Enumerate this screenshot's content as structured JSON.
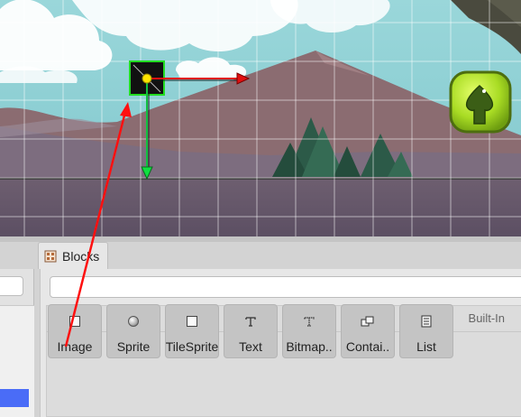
{
  "colors": {
    "sky": "#8fd3d8",
    "mountain": "#8a6a6e",
    "ground": "#6a5a6e",
    "selection_accent": "#4a6cf7",
    "x_axis_arrow": "#e01010",
    "y_axis_arrow": "#10c040",
    "gizmo_border": "#22dd22",
    "pointer_arrow": "#ff1010",
    "home_button": "#9fdc2a"
  },
  "scene": {
    "elements": [
      {
        "name": "transform-gizmo",
        "kind": "selected-object"
      },
      {
        "name": "home-button",
        "icon": "up-arrow-icon"
      }
    ]
  },
  "tabs": [
    {
      "label": "Blocks",
      "icon": "blocks-tab-icon"
    }
  ],
  "blocks_panel": {
    "search": {
      "value": "",
      "placeholder": ""
    },
    "group_label": "Built-In",
    "items": [
      {
        "label": "Image",
        "icon": "image-icon"
      },
      {
        "label": "Sprite",
        "icon": "sprite-icon"
      },
      {
        "label": "TileSprite",
        "icon": "tilesprite-icon"
      },
      {
        "label": "Text",
        "icon": "text-icon"
      },
      {
        "label": "Bitmap..",
        "icon": "bitmap-text-icon"
      },
      {
        "label": "Contai..",
        "icon": "container-icon"
      },
      {
        "label": "List",
        "icon": "list-icon"
      }
    ]
  }
}
